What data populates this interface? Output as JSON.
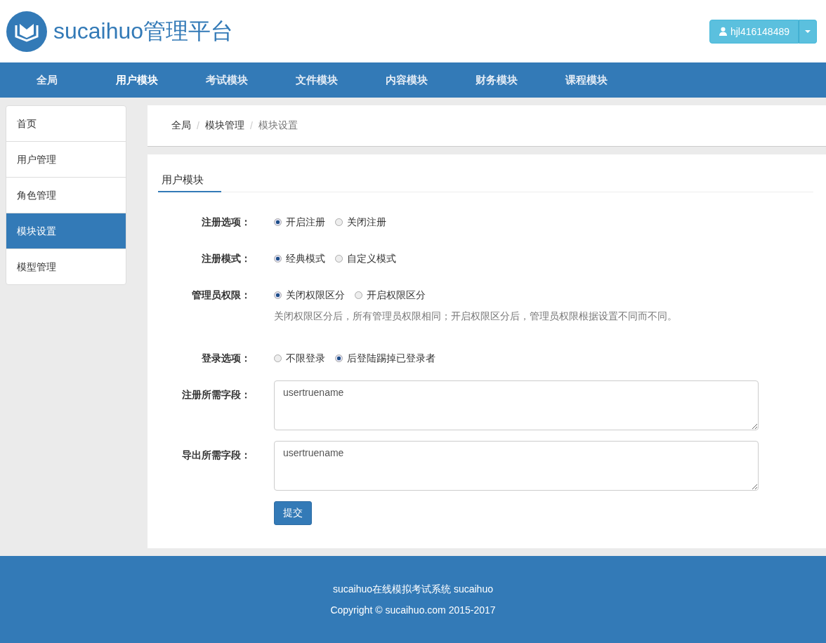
{
  "brand": {
    "title": "sucaihuo管理平台"
  },
  "user_menu": {
    "username": "hjl416148489"
  },
  "nav": [
    {
      "label": "全局",
      "selected": false
    },
    {
      "label": "用户模块",
      "selected": true
    },
    {
      "label": "考试模块",
      "selected": false
    },
    {
      "label": "文件模块",
      "selected": false
    },
    {
      "label": "内容模块",
      "selected": false
    },
    {
      "label": "财务模块",
      "selected": false
    },
    {
      "label": "课程模块",
      "selected": false
    }
  ],
  "sidebar": {
    "items": [
      {
        "label": "首页",
        "selected": false
      },
      {
        "label": "用户管理",
        "selected": false
      },
      {
        "label": "角色管理",
        "selected": false
      },
      {
        "label": "模块设置",
        "selected": true
      },
      {
        "label": "模型管理",
        "selected": false
      }
    ]
  },
  "breadcrumb": {
    "separator": "/",
    "items": [
      "全局",
      "模块管理",
      "模块设置"
    ]
  },
  "form": {
    "tab": "用户模块",
    "fields": [
      {
        "kind": "radio",
        "label": "注册选项：",
        "options": [
          {
            "label": "开启注册",
            "selected": true
          },
          {
            "label": "关闭注册",
            "selected": false
          }
        ]
      },
      {
        "kind": "radio",
        "label": "注册模式：",
        "options": [
          {
            "label": "经典模式",
            "selected": true
          },
          {
            "label": "自定义模式",
            "selected": false
          }
        ]
      },
      {
        "kind": "radio",
        "label": "管理员权限：",
        "options": [
          {
            "label": "关闭权限区分",
            "selected": true
          },
          {
            "label": "开启权限区分",
            "selected": false
          }
        ],
        "help": "关闭权限区分后，所有管理员权限相同；开启权限区分后，管理员权限根据设置不同而不同。"
      },
      {
        "kind": "radio",
        "label": "登录选项：",
        "options": [
          {
            "label": "不限登录",
            "selected": false
          },
          {
            "label": "后登陆踢掉已登录者",
            "selected": true
          }
        ]
      },
      {
        "kind": "textarea",
        "label": "注册所需字段：",
        "value": "usertruename"
      },
      {
        "kind": "textarea",
        "label": "导出所需字段：",
        "value": "usertruename"
      }
    ],
    "submit": "提交"
  },
  "footer": {
    "lines": [
      "sucaihuo在线模拟考试系统 sucaihuo",
      "Copyright © sucaihuo.com 2015-2017"
    ]
  }
}
